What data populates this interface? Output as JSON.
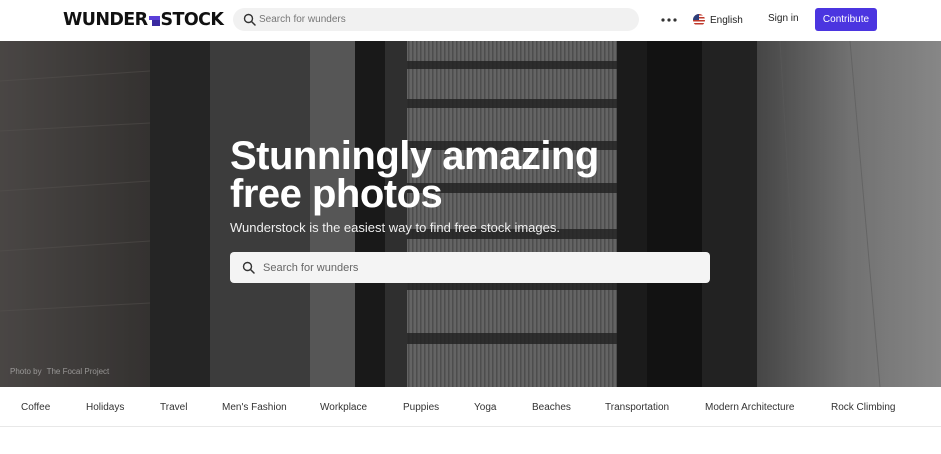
{
  "header": {
    "logo_left": "WUNDER",
    "logo_right": "STOCK",
    "search_placeholder": "Search for wunders",
    "language": "English",
    "signin_label": "Sign in",
    "contribute_label": "Contribute"
  },
  "hero": {
    "title_line1": "Stunningly amazing",
    "title_line2": "free photos",
    "subtitle": "Wunderstock is the easiest way to find free stock images.",
    "search_placeholder": "Search for wunders",
    "credit_prefix": "Photo by",
    "credit_author": "The Focal Project"
  },
  "categories": [
    "Coffee",
    "Holidays",
    "Travel",
    "Men's Fashion",
    "Workplace",
    "Puppies",
    "Yoga",
    "Beaches",
    "Transportation",
    "Modern Architecture",
    "Rock Climbing"
  ],
  "colors": {
    "accent": "#4b35e0",
    "hero_overlay": "#2a2a2a"
  },
  "icons": {
    "search": "search-icon",
    "more": "more-dots-icon",
    "language": "flag-icon"
  }
}
